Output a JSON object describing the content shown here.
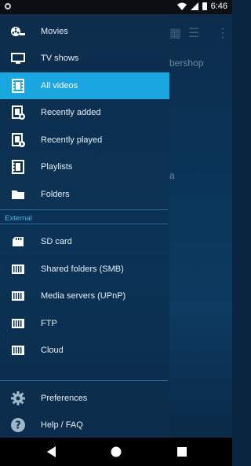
{
  "status": {
    "time": "6:46"
  },
  "background": {
    "fragments": [
      "bershop",
      "a"
    ]
  },
  "drawer": {
    "items": [
      {
        "label": "Movies",
        "icon": "film-reel-icon"
      },
      {
        "label": "TV shows",
        "icon": "tv-icon"
      },
      {
        "label": "All videos",
        "icon": "film-strip-icon",
        "active": true
      },
      {
        "label": "Recently added",
        "icon": "film-add-icon"
      },
      {
        "label": "Recently played",
        "icon": "film-play-icon"
      },
      {
        "label": "Playlists",
        "icon": "film-list-icon"
      },
      {
        "label": "Folders",
        "icon": "folder-icon"
      }
    ],
    "external_title": "External",
    "external_items": [
      {
        "label": "SD card",
        "icon": "sd-card-icon"
      },
      {
        "label": "Shared folders (SMB)",
        "icon": "server-icon"
      },
      {
        "label": "Media servers (UPnP)",
        "icon": "server-icon"
      },
      {
        "label": "FTP",
        "icon": "server-icon"
      },
      {
        "label": "Cloud",
        "icon": "server-icon"
      }
    ],
    "bottom_items": [
      {
        "label": "Preferences",
        "icon": "gear-icon"
      },
      {
        "label": "Help / FAQ",
        "icon": "help-icon"
      }
    ]
  },
  "colors": {
    "accent": "#1aa6e0",
    "section": "#4db4e8",
    "drawer_bg": "#0b3356"
  }
}
